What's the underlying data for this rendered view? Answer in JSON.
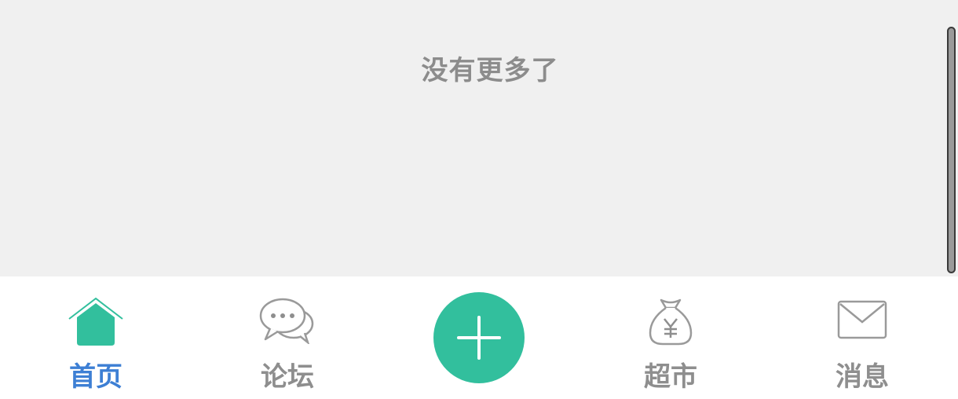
{
  "list": {
    "end_text": "没有更多了"
  },
  "tabbar": {
    "tabs": [
      {
        "label": "首页",
        "icon": "home-icon",
        "active": true
      },
      {
        "label": "论坛",
        "icon": "chat-bubbles-icon",
        "active": false
      },
      {
        "label": "超市",
        "icon": "money-bag-icon",
        "active": false
      },
      {
        "label": "消息",
        "icon": "envelope-icon",
        "active": false
      }
    ],
    "center_button": {
      "icon": "plus-icon"
    }
  },
  "colors": {
    "accent": "#32bf9d",
    "active_label": "#3d7fd4",
    "inactive": "#8e8e8e",
    "background": "#f0f0f0"
  }
}
